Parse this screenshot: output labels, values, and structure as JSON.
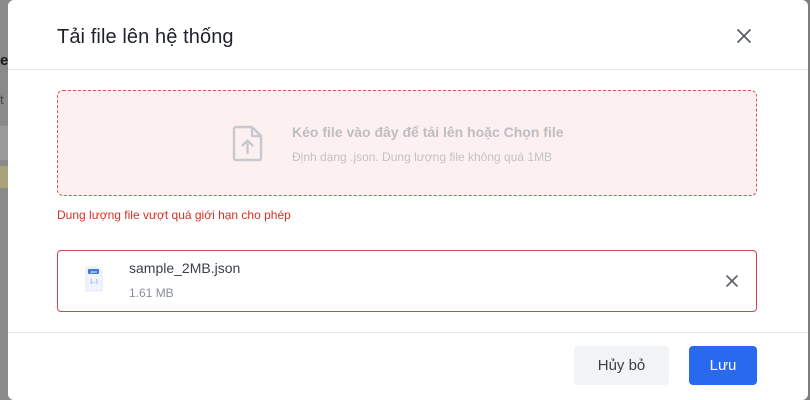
{
  "background": {
    "fragment_1": "e",
    "fragment_2": "t"
  },
  "modal": {
    "title": "Tải file lên hệ thống",
    "close_icon": "close-icon",
    "dropzone": {
      "icon": "file-upload-icon",
      "title": "Kéo file vào đây để tải lên hoặc Chọn file",
      "subtitle": "Định dạng .json. Dung lượng file không quá 1MB"
    },
    "error_message": "Dung lượng file vượt quá giới hạn cho phép",
    "file": {
      "icon": "json-file-icon",
      "icon_badge": ".json",
      "icon_glyph": "{...}",
      "name": "sample_2MB.json",
      "size": "1.61 MB",
      "remove_icon": "close-icon"
    },
    "footer": {
      "cancel_label": "Hủy bỏ",
      "save_label": "Lưu"
    }
  },
  "colors": {
    "accent": "#2869f0",
    "error": "#d93025",
    "error_border": "#d64545",
    "dropzone_bg": "#fdf0f0"
  }
}
